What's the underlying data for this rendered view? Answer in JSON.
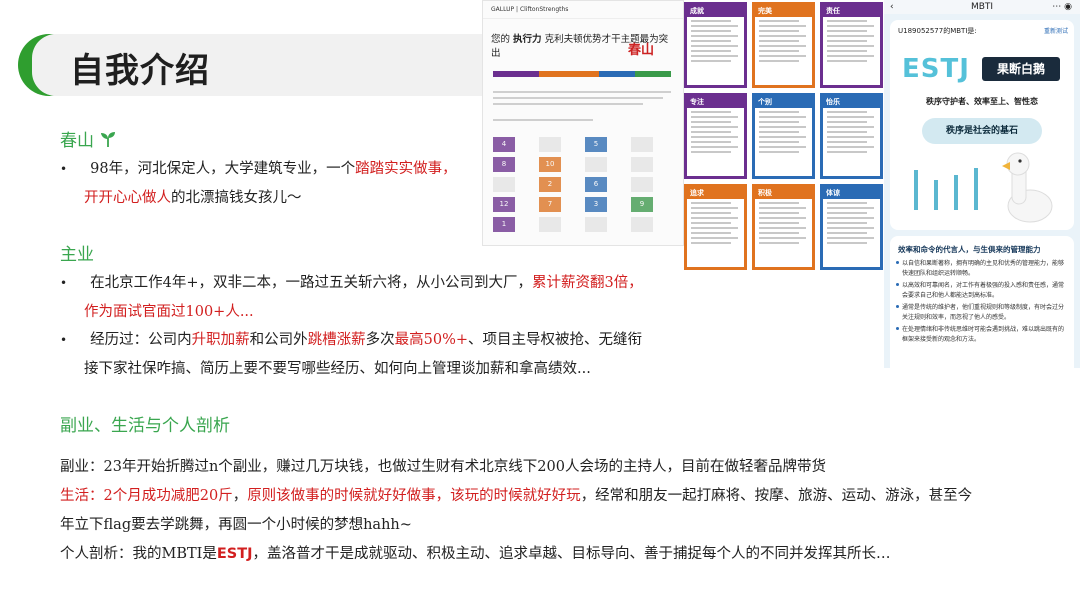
{
  "title": "自我介绍",
  "section1": {
    "heading": "春山",
    "heading_icon": "sprout-icon",
    "bullet_pre": "98年，河北保定人，大学建筑专业，一个",
    "bullet_red1": "踏踏实实做事，",
    "bullet_red2": "开开心心做人",
    "bullet_post": "的北漂搞钱女孩儿～"
  },
  "section2": {
    "heading": "主业",
    "b1_pre": "在北京工作4年+，双非二本，一路过五关斩六将，从小公司到大厂，",
    "b1_red1": "累计薪资翻3倍，",
    "b1_red2": "作为面试官面过100+人...",
    "b2_a": "经历过：公司内",
    "b2_red1": "升职加薪",
    "b2_b": "和公司外",
    "b2_red2": "跳槽涨薪",
    "b2_c": "多次",
    "b2_red3": "最高50%+",
    "b2_d": "、项目主导权被抢、无缝衔",
    "b2_line2": "接下家社保咋搞、简历上要不要写哪些经历、如何向上管理谈加薪和拿高绩效..."
  },
  "section3": {
    "heading": "副业、生活与个人剖析",
    "side": "副业：23年开始折腾过n个副业，赚过几万块钱，也做过生财有术北京线下200人会场的主持人，目前在做轻奢品牌带货",
    "life_label": "生活：",
    "life_red1": "2个月成功减肥20斤",
    "life_mid": "，",
    "life_red2": "原则该做事的时候就好好做事，该玩的时候就好好玩",
    "life_post": "，经常和朋友一起打麻将、按摩、旅游、运动、游泳，甚至今",
    "life_line2": "年立下flag要去学跳舞，再圆一个小时候的梦想hahh~",
    "anal_pre": "个人剖析：我的MBTI是",
    "anal_red": "ESTJ",
    "anal_post": "，盖洛普才干是成就驱动、积极主动、追求卓越、目标导向、善于捕捉每个人的不同并发挥其所长…"
  },
  "gallup_report": {
    "brand": "GALLUP | CliftonStrengths",
    "title_pre": "您的",
    "title_bold": "执行力",
    "title_post": "克利夫顿优势才干主题最为突出",
    "signature": "春山",
    "grid_numbers": [
      "4",
      "8",
      "5",
      "10",
      "2",
      "6",
      "9",
      "12",
      "7",
      "3",
      "1"
    ]
  },
  "gallup_cards": [
    {
      "label": "成就",
      "color": "#6b2f8f"
    },
    {
      "label": "完美",
      "color": "#e0731f"
    },
    {
      "label": "责任",
      "color": "#6b2f8f"
    },
    {
      "label": "专注",
      "color": "#6b2f8f"
    },
    {
      "label": "个别",
      "color": "#2a6bb5"
    },
    {
      "label": "怡乐",
      "color": "#2a6bb5"
    },
    {
      "label": "追求",
      "color": "#e0731f"
    },
    {
      "label": "积极",
      "color": "#e0731f"
    },
    {
      "label": "体谅",
      "color": "#2a6bb5"
    }
  ],
  "phone": {
    "nav_title": "MBTI",
    "user": "U189052577的MBTI是:",
    "retest": "重新测试",
    "type": "ESTJ",
    "type_name": "果断白鹅",
    "subtitle": "秩序守护者、效率至上、智性恋",
    "pill": "秩序是社会的基石",
    "lower_heading": "效率和命令的代言人，与生俱来的管理能力",
    "lower_items": [
      "以自信和果断著称，拥有明确的主见和优秀的管理能力，能够快速团队和组织运转顺畅。",
      "以高效和可靠闻名，对工作有着极强的投入感和责任感，通常会要求自己和他人都能达到高标准。",
      "通常是传统的维护者，他们重视规则和等级制度，有时会过分关注规则和效率，而忽视了他人的感受。",
      "在处理情绪和非传统思维时可能会遇到挑战，难以跳出既有的框架来接受新的观念和方法。"
    ]
  }
}
